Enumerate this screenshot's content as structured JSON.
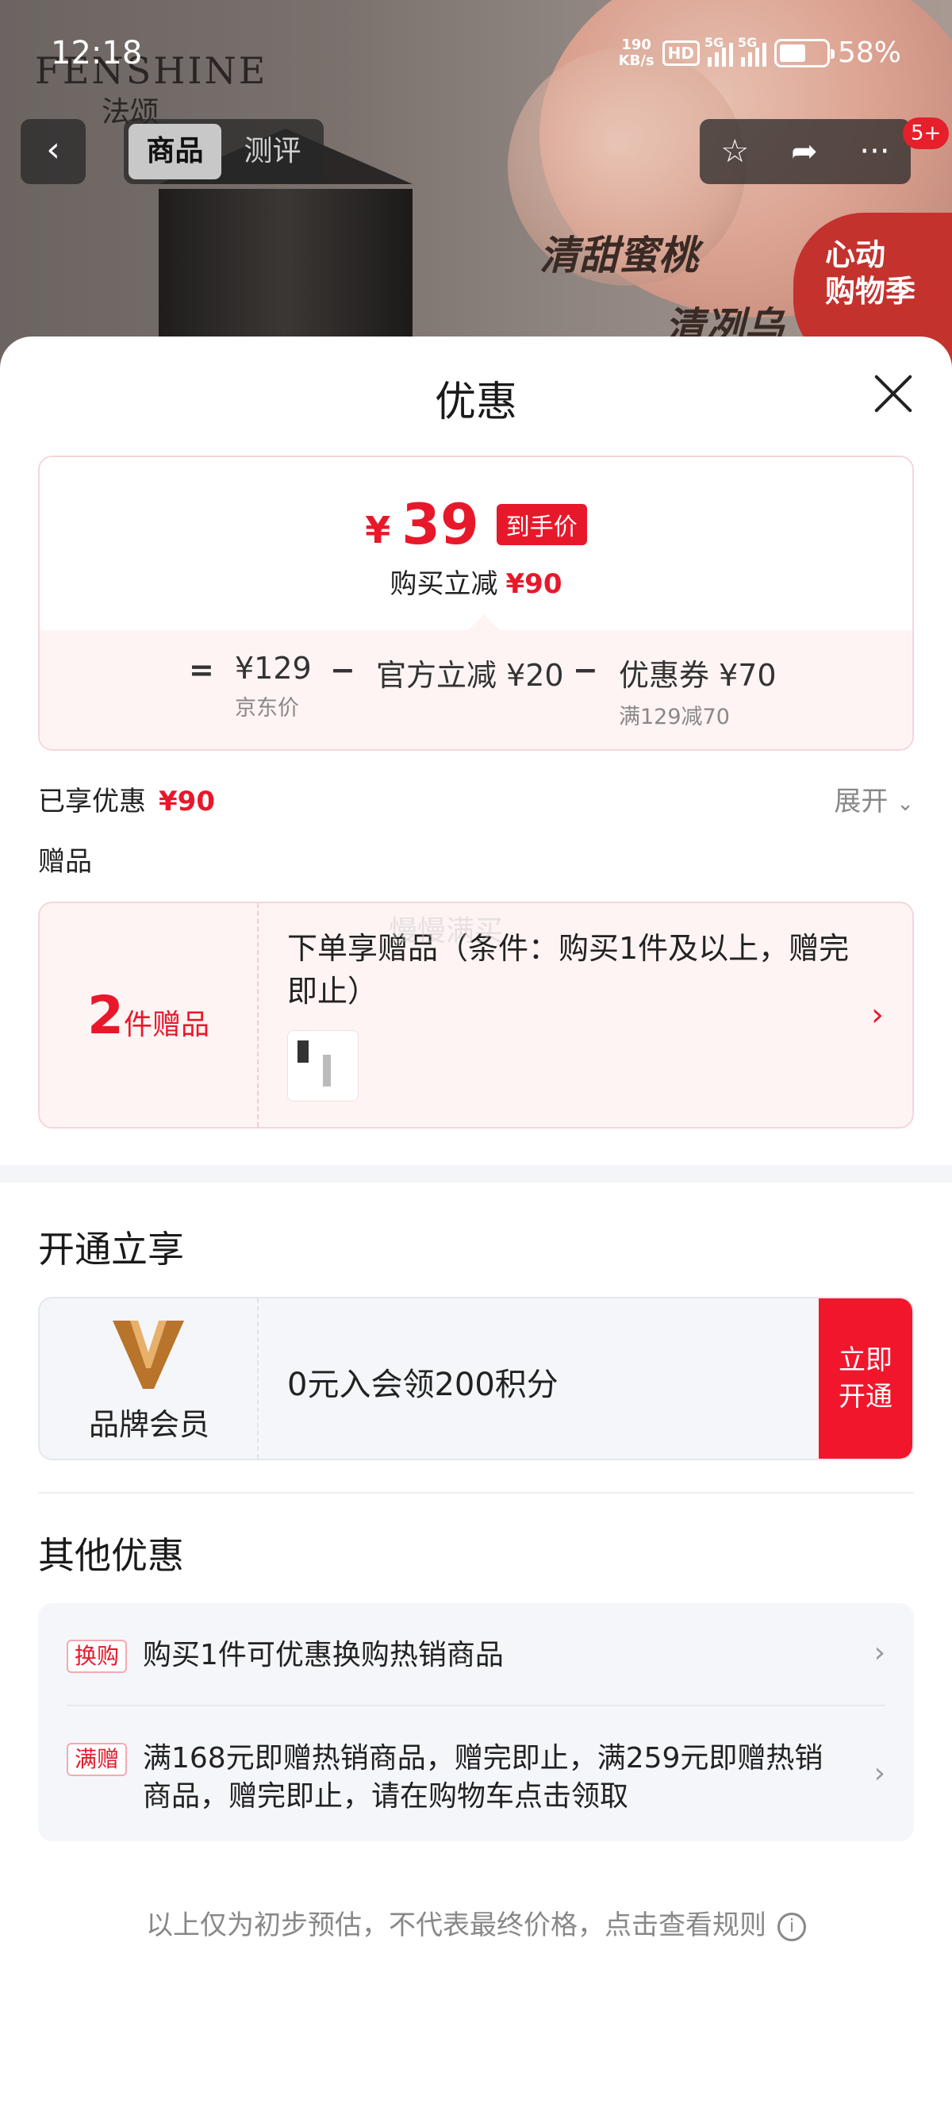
{
  "status_bar": {
    "time": "12:18",
    "net_speed_value": "190",
    "net_speed_unit": "KB/s",
    "hd_label": "HD",
    "signal_1_label": "5G",
    "signal_2_label": "5G",
    "battery_percent": 58,
    "battery_text": "58%"
  },
  "background": {
    "brand_en": "FENSHINE",
    "brand_cn": "法颂",
    "slogan_line1": "清甜蜜桃",
    "slogan_line2": "清冽乌",
    "promo_badge": "心动\n购物季"
  },
  "top_nav": {
    "tabs": [
      "商品",
      "测评"
    ],
    "active_tab": "商品",
    "more_badge": "5+",
    "icons": [
      "back-arrow-icon",
      "star-icon",
      "share-icon",
      "more-dots-icon"
    ]
  },
  "sheet": {
    "title": "优惠",
    "price": {
      "currency": "¥",
      "final_price": "39",
      "final_tag": "到手价",
      "reduce_label": "购买立减",
      "reduce_value": "¥90"
    },
    "formula": {
      "equals": "=",
      "minus": "−",
      "items": [
        {
          "main": "¥129",
          "sub": "京东价"
        },
        {
          "main": "官方立减 ¥20",
          "sub": ""
        },
        {
          "main": "优惠券 ¥70",
          "sub": "满129减70"
        }
      ]
    },
    "enjoyed_label": "已享优惠",
    "enjoyed_value": "¥90",
    "expand_label": "展开",
    "gift_section_title": "赠品",
    "gift": {
      "count": "2",
      "count_unit": "件赠品",
      "description": "下单享赠品（条件：购买1件及以上，赠完即止）"
    },
    "watermark": "慢慢满买",
    "membership_title": "开通立享",
    "membership": {
      "label": "品牌会员",
      "offer": "0元入会领200积分",
      "button": "立即\n开通"
    },
    "other_title": "其他优惠",
    "other_items": [
      {
        "tag": "换购",
        "text": "购买1件可优惠换购热销商品"
      },
      {
        "tag": "满赠",
        "text": "满168元即赠热销商品，赠完即止，满259元即赠热销商品，赠完即止，请在购物车点击领取"
      }
    ],
    "footnote": "以上仅为初步预估，不代表最终价格，点击查看规则"
  },
  "colors": {
    "accent_red": "#e8182b",
    "card_pink": "#fff4f4",
    "card_gray": "#f5f6fa",
    "member_gold": "#b8742a"
  }
}
